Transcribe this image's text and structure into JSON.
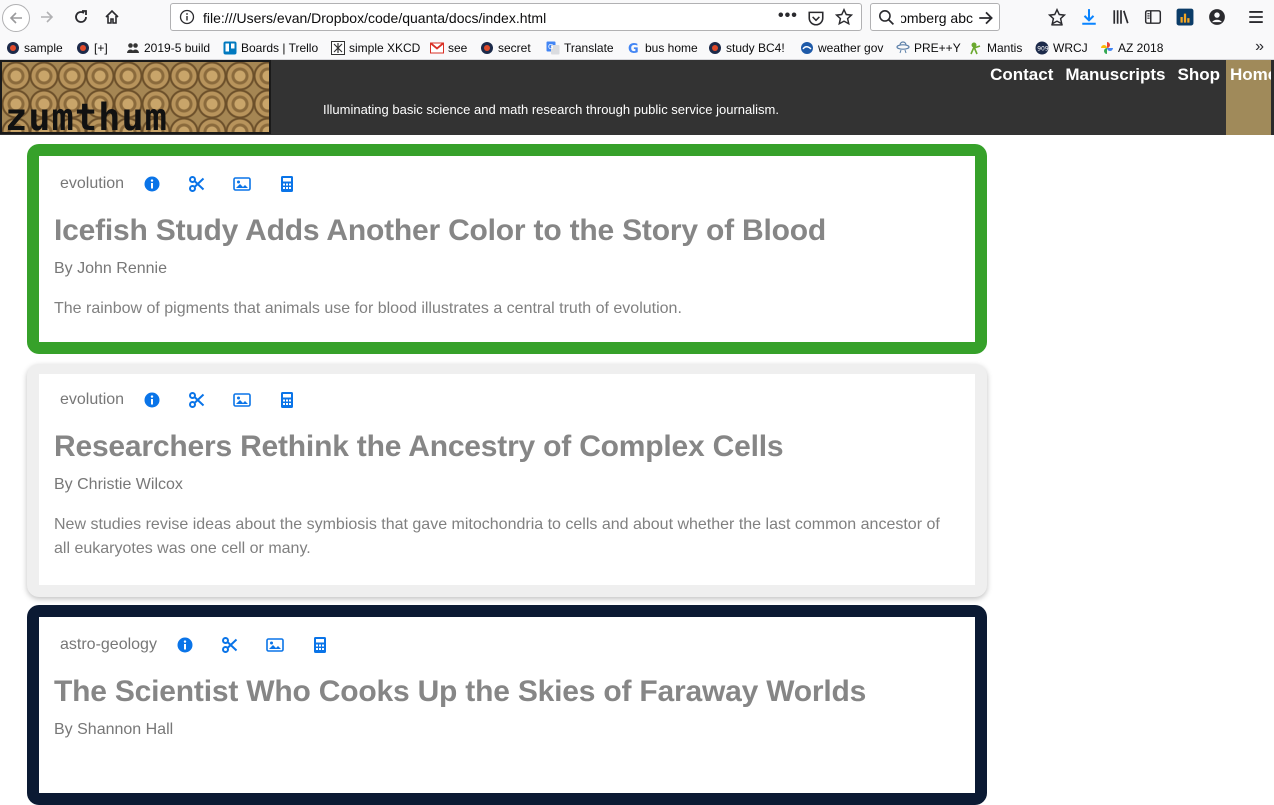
{
  "browser": {
    "url": "file:///Users/evan/Dropbox/code/quanta/docs/index.html",
    "page_actions": "•••",
    "search_text": "Bloomberg abc"
  },
  "bookmarks": [
    {
      "label": "sample",
      "icon": "globe-icon"
    },
    {
      "label": "[+]",
      "icon": "globe-icon"
    },
    {
      "label": "2019-5 build",
      "icon": "people-icon"
    },
    {
      "label": "Boards | Trello",
      "icon": "trello-icon"
    },
    {
      "label": "simple XKCD",
      "icon": "xkcd-icon"
    },
    {
      "label": "see",
      "icon": "gmail-icon"
    },
    {
      "label": "secret",
      "icon": "globe-icon"
    },
    {
      "label": "Translate",
      "icon": "translate-icon"
    },
    {
      "label": "bus home",
      "icon": "google-icon"
    },
    {
      "label": "study BC4!",
      "icon": "globe-icon"
    },
    {
      "label": "weather gov",
      "icon": "weather-icon"
    },
    {
      "label": "PRE++Y",
      "icon": "ufo-icon"
    },
    {
      "label": "Mantis",
      "icon": "mantis-icon"
    },
    {
      "label": "WRCJ",
      "icon": "radio-icon"
    },
    {
      "label": "AZ 2018",
      "icon": "photos-icon"
    }
  ],
  "site": {
    "logo_text": "zumthum",
    "tagline": "Illuminating basic science and math research through public service journalism.",
    "nav": [
      "Contact",
      "Manuscripts",
      "Shop",
      "Home"
    ]
  },
  "colors": {
    "card_green": "#36a12a",
    "card_gray": "#efefef",
    "card_navy": "#0b1a33",
    "icon_blue": "#0a74e8",
    "header": "#333333",
    "home_active": "#a08a5a"
  },
  "articles": [
    {
      "tag": "evolution",
      "title": "Icefish Study Adds Another Color to the Story of Blood",
      "byline": "By John Rennie",
      "summary": "The rainbow of pigments that animals use for blood illustrates a central truth of evolution."
    },
    {
      "tag": "evolution",
      "title": "Researchers Rethink the Ancestry of Complex Cells",
      "byline": "By Christie Wilcox",
      "summary": "New studies revise ideas about the symbiosis that gave mitochondria to cells and about whether the last common ancestor of all eukaryotes was one cell or many."
    },
    {
      "tag": "astro-geology",
      "title": "The Scientist Who Cooks Up the Skies of Faraway Worlds",
      "byline": "By Shannon Hall",
      "summary": ""
    }
  ]
}
